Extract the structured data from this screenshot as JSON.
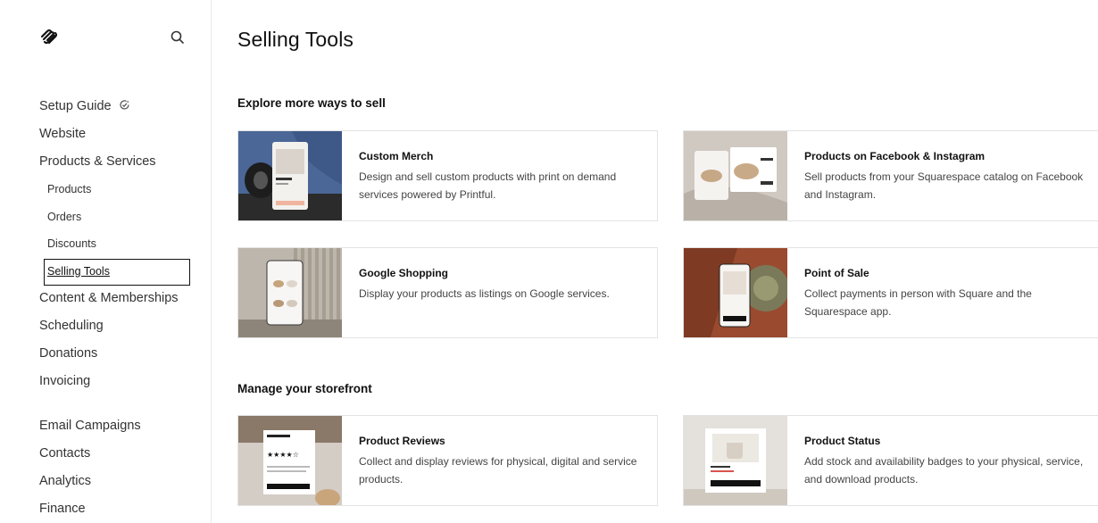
{
  "sidebar": {
    "logo_icon": "squarespace-logo",
    "search_icon": "search-icon",
    "items": [
      {
        "label": "Setup Guide"
      },
      {
        "label": "Website"
      },
      {
        "label": "Products & Services"
      },
      {
        "label": "Products"
      },
      {
        "label": "Orders"
      },
      {
        "label": "Discounts"
      },
      {
        "label": "Selling Tools"
      },
      {
        "label": "Content & Memberships"
      },
      {
        "label": "Scheduling"
      },
      {
        "label": "Donations"
      },
      {
        "label": "Invoicing"
      },
      {
        "label": "Email Campaigns"
      },
      {
        "label": "Contacts"
      },
      {
        "label": "Analytics"
      },
      {
        "label": "Finance"
      }
    ]
  },
  "main": {
    "title": "Selling Tools",
    "sections": [
      {
        "title": "Explore more ways to sell",
        "cards": [
          {
            "title": "Custom Merch",
            "description": "Design and sell custom products with print on demand services powered by Printful."
          },
          {
            "title": "Products on Facebook & Instagram",
            "description": "Sell products from your Squarespace catalog on Facebook and Instagram."
          },
          {
            "title": "Google Shopping",
            "description": "Display your products as listings on Google services."
          },
          {
            "title": "Point of Sale",
            "description": "Collect payments in person with Square and the Squarespace app."
          }
        ]
      },
      {
        "title": "Manage your storefront",
        "cards": [
          {
            "title": "Product Reviews",
            "description": "Collect and display reviews for physical, digital and service products."
          },
          {
            "title": "Product Status",
            "description": "Add stock and availability badges to your physical, service, and download products."
          }
        ]
      }
    ]
  }
}
